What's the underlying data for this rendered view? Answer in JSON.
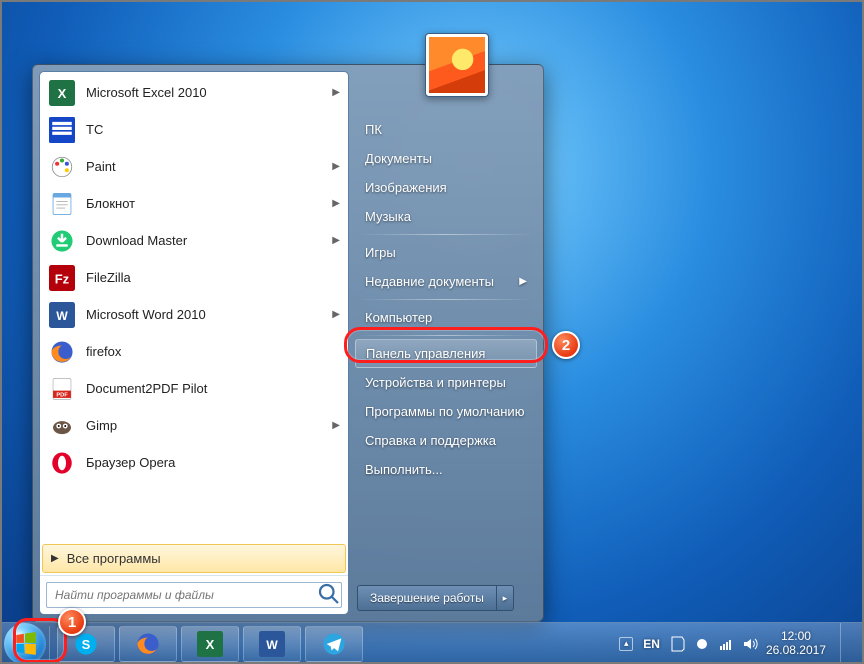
{
  "programs": [
    {
      "label": "Microsoft Excel 2010",
      "has_sub": true,
      "icon": "excel"
    },
    {
      "label": "TC",
      "has_sub": false,
      "icon": "tc"
    },
    {
      "label": "Paint",
      "has_sub": true,
      "icon": "paint"
    },
    {
      "label": "Блокнот",
      "has_sub": true,
      "icon": "notepad"
    },
    {
      "label": "Download Master",
      "has_sub": true,
      "icon": "dm"
    },
    {
      "label": "FileZilla",
      "has_sub": false,
      "icon": "fz"
    },
    {
      "label": "Microsoft Word 2010",
      "has_sub": true,
      "icon": "word"
    },
    {
      "label": "firefox",
      "has_sub": false,
      "icon": "ff"
    },
    {
      "label": "Document2PDF Pilot",
      "has_sub": false,
      "icon": "pdf"
    },
    {
      "label": "Gimp",
      "has_sub": true,
      "icon": "gimp"
    },
    {
      "label": "Браузер Opera",
      "has_sub": false,
      "icon": "opera"
    }
  ],
  "all_programs_label": "Все программы",
  "search_placeholder": "Найти программы и файлы",
  "right_items": [
    {
      "label": "ПК",
      "type": "item"
    },
    {
      "label": "Документы",
      "type": "item"
    },
    {
      "label": "Изображения",
      "type": "item"
    },
    {
      "label": "Музыка",
      "type": "item"
    },
    {
      "type": "sep"
    },
    {
      "label": "Игры",
      "type": "item"
    },
    {
      "label": "Недавние документы",
      "type": "item",
      "submenu": true
    },
    {
      "type": "sep"
    },
    {
      "label": "Компьютер",
      "type": "item"
    },
    {
      "type": "sep"
    },
    {
      "label": "Панель управления",
      "type": "item",
      "highlight": true
    },
    {
      "label": "Устройства и принтеры",
      "type": "item"
    },
    {
      "label": "Программы по умолчанию",
      "type": "item"
    },
    {
      "label": "Справка и поддержка",
      "type": "item"
    },
    {
      "label": "Выполнить...",
      "type": "item"
    }
  ],
  "shutdown_label": "Завершение работы",
  "taskbar": {
    "items": [
      "skype",
      "firefox",
      "excel",
      "word",
      "telegram"
    ]
  },
  "tray": {
    "lang": "EN",
    "time": "12:00",
    "date": "26.08.2017"
  },
  "annotations": {
    "badge1": "1",
    "badge2": "2"
  }
}
